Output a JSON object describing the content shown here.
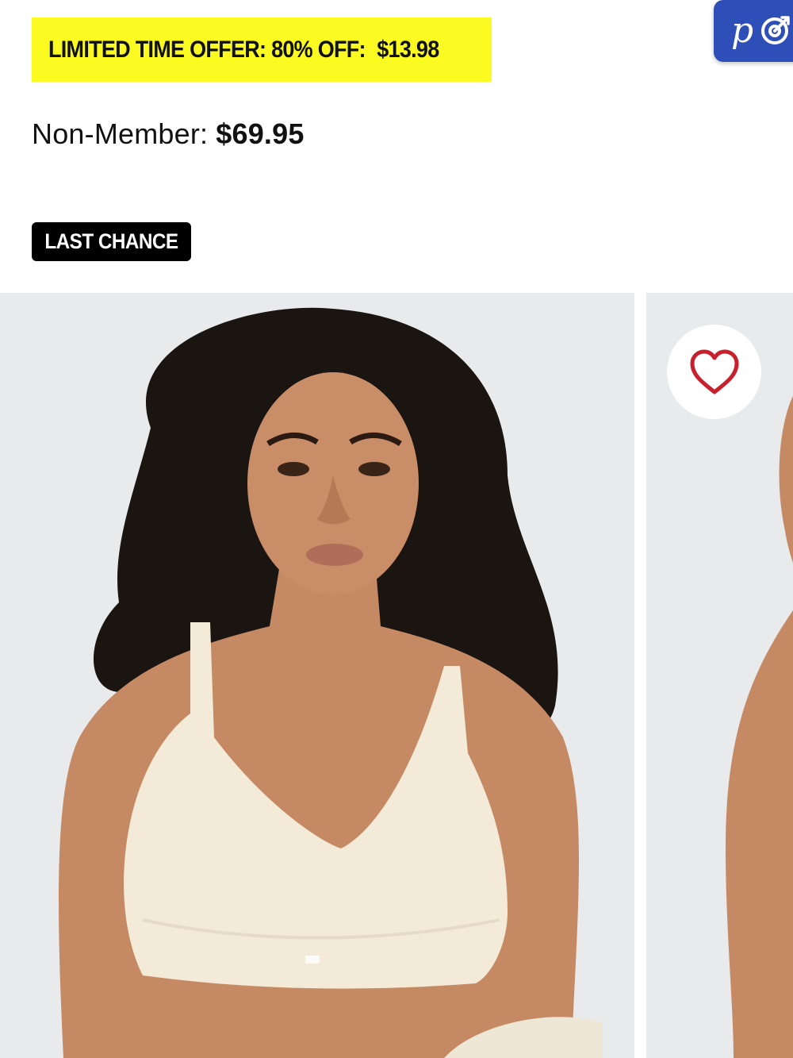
{
  "offer": {
    "label": "LIMITED TIME OFFER: 80% OFF:",
    "price": "$13.98"
  },
  "member": {
    "label": "Non-Member:",
    "price": "$69.95"
  },
  "badge": {
    "label": "LAST CHANCE"
  },
  "corner_badge": {
    "letter": "p",
    "icon": "target-icon"
  },
  "gallery": {
    "images": [
      {
        "name": "product-photo-front",
        "icon": "photo"
      },
      {
        "name": "product-photo-side",
        "icon": "photo"
      }
    ],
    "wishlist_icon": "heart-outline-icon"
  },
  "colors": {
    "offer_banner": "#fbfb22",
    "badge_bg": "#000000",
    "corner_badge_bg": "#2f4fb8",
    "heart": "#c8202c",
    "photo_bg": "#e9eaec"
  }
}
